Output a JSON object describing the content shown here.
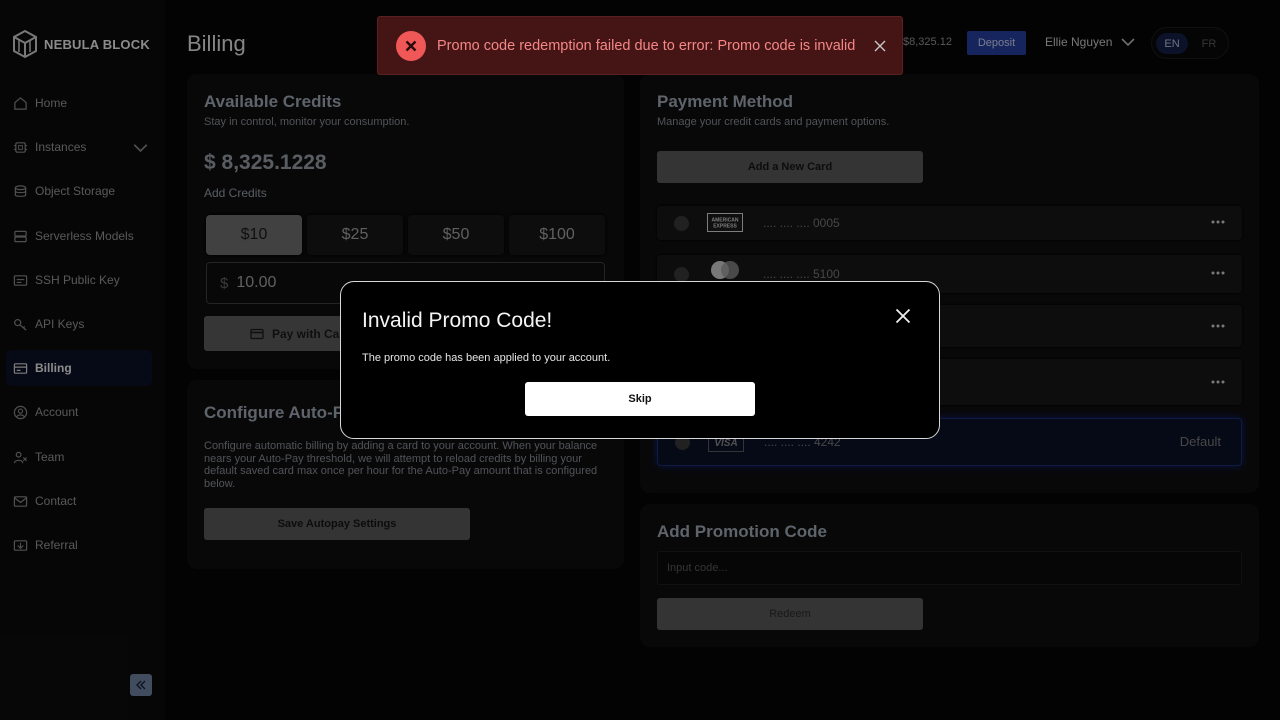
{
  "app": {
    "name": "NEBULA BLOCK"
  },
  "sidebar": {
    "items": [
      {
        "label": "Home",
        "icon": "home-icon"
      },
      {
        "label": "Instances",
        "icon": "cpu-icon"
      },
      {
        "label": "Object Storage",
        "icon": "database-icon"
      },
      {
        "label": "Serverless Models",
        "icon": "server-icon"
      },
      {
        "label": "SSH Public Key",
        "icon": "key-card-icon"
      },
      {
        "label": "API Keys",
        "icon": "key-icon"
      },
      {
        "label": "Billing",
        "icon": "billing-card-icon",
        "active": true
      },
      {
        "label": "Account",
        "icon": "user-circle-icon"
      },
      {
        "label": "Team",
        "icon": "team-icon"
      },
      {
        "label": "Contact",
        "icon": "mail-icon"
      },
      {
        "label": "Referral",
        "icon": "referral-icon"
      }
    ]
  },
  "header": {
    "title": "Billing",
    "balance": "$8,325.12",
    "deposit_label": "Deposit",
    "user_name": "Ellie Nguyen",
    "languages": [
      "EN",
      "FR"
    ],
    "active_language": "EN"
  },
  "credits": {
    "title": "Available Credits",
    "subtitle": "Stay in control, monitor your consumption.",
    "amount": "$ 8,325.1228",
    "add_label": "Add Credits",
    "options": [
      "$10",
      "$25",
      "$50",
      "$100"
    ],
    "selected_option": "$10",
    "currency_symbol": "$",
    "input_value": "10.00",
    "pay_label": "Pay with Ca"
  },
  "autopay": {
    "title": "Configure Auto-P",
    "description": "Configure automatic billing by adding a card to your account. When your balance nears your Auto-Pay threshold, we will attempt to reload credits by billing your default saved card max once per hour for the Auto-Pay amount that is configured below.",
    "save_label": "Save Autopay Settings"
  },
  "payment": {
    "title": "Payment Method",
    "subtitle": "Manage your credit cards and payment options.",
    "add_card_label": "Add a New Card",
    "cards": [
      {
        "brand": "amex-logo",
        "number": ".... .... .... 0005"
      },
      {
        "brand": "mastercard-logo",
        "number": ".... .... .... 5100"
      },
      {
        "brand": "",
        "number": ""
      },
      {
        "brand": "",
        "number": ""
      },
      {
        "brand": "visa-logo",
        "number": ".... .... .... 4242",
        "default_label": "Default"
      }
    ]
  },
  "promo": {
    "title": "Add Promotion Code",
    "placeholder": "Input code...",
    "redeem_label": "Redeem"
  },
  "toast": {
    "message": "Promo code redemption failed due to error: Promo code is invalid",
    "color": "#f05757"
  },
  "modal": {
    "title": "Invalid Promo Code!",
    "message": "The promo code has been applied to your account.",
    "skip_label": "Skip"
  }
}
